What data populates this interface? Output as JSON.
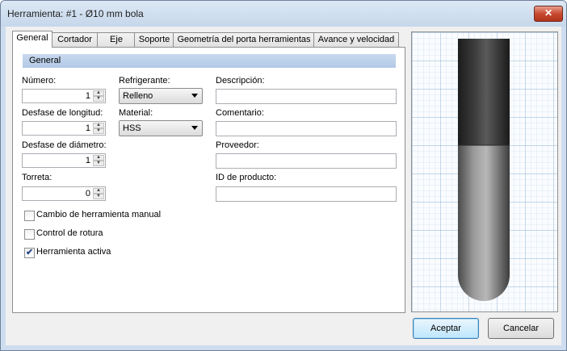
{
  "window": {
    "title": "Herramienta: #1 - Ø10 mm bola",
    "close_glyph": "✕"
  },
  "tabs": [
    {
      "label": "General",
      "active": true
    },
    {
      "label": "Cortador"
    },
    {
      "label": "Eje"
    },
    {
      "label": "Soporte"
    },
    {
      "label": "Geometría del porta herramientas"
    },
    {
      "label": "Avance y velocidad"
    }
  ],
  "section": {
    "title": "General"
  },
  "fields": {
    "numero": {
      "label": "Número:",
      "value": "1"
    },
    "desfase_longitud": {
      "label": "Desfase de longitud:",
      "value": "1"
    },
    "desfase_diametro": {
      "label": "Desfase de diámetro:",
      "value": "1"
    },
    "torreta": {
      "label": "Torreta:",
      "value": "0"
    },
    "refrigerante": {
      "label": "Refrigerante:",
      "value": "Relleno"
    },
    "material": {
      "label": "Material:",
      "value": "HSS"
    },
    "descripcion": {
      "label": "Descripción:",
      "value": ""
    },
    "comentario": {
      "label": "Comentario:",
      "value": ""
    },
    "proveedor": {
      "label": "Proveedor:",
      "value": ""
    },
    "id_producto": {
      "label": "ID de producto:",
      "value": ""
    }
  },
  "checkboxes": [
    {
      "label": "Cambio de herramienta manual",
      "checked": false
    },
    {
      "label": "Control de rotura",
      "checked": false
    },
    {
      "label": "Herramienta activa",
      "checked": true
    }
  ],
  "buttons": {
    "ok": "Aceptar",
    "cancel": "Cancelar"
  },
  "icons": {
    "check": "✔",
    "spin_up": "▲",
    "spin_down": "▼"
  },
  "colors": {
    "accent": "#b1c8e6",
    "grid_minor": "#c4d8ea",
    "grid_major": "#8fb0cf"
  }
}
